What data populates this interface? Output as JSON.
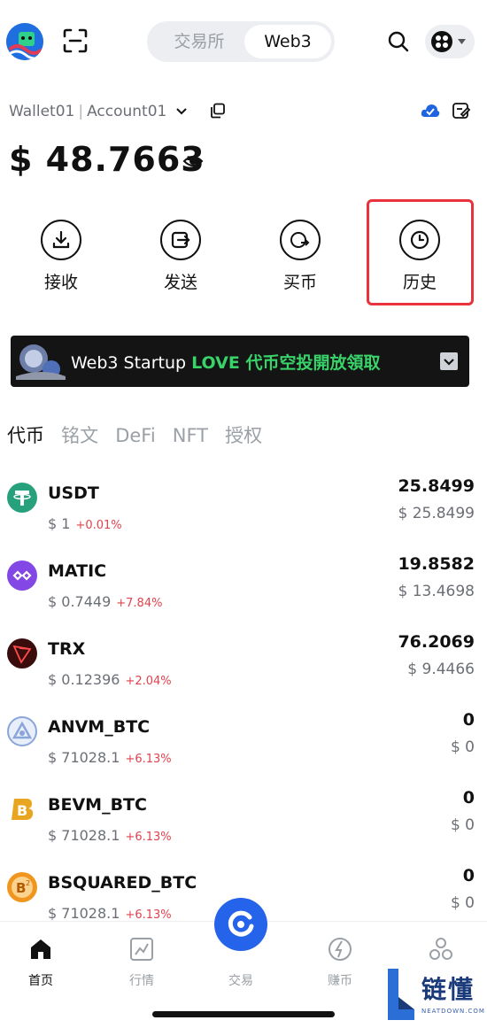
{
  "header": {
    "segment_options": [
      "交易所",
      "Web3"
    ],
    "selected_segment": "Web3"
  },
  "wallet": {
    "wallet_name": "Wallet01",
    "account_name": "Account01",
    "balance": "$ 48.7663"
  },
  "actions": [
    {
      "label": "接收",
      "icon": "receive-icon"
    },
    {
      "label": "发送",
      "icon": "send-icon"
    },
    {
      "label": "买币",
      "icon": "buy-icon"
    },
    {
      "label": "历史",
      "icon": "history-icon"
    }
  ],
  "banner": {
    "text_white": "Web3 Startup ",
    "text_green": "LOVE 代币空投開放領取"
  },
  "tabs": [
    "代币",
    "铭文",
    "DeFi",
    "NFT",
    "授权"
  ],
  "active_tab": "代币",
  "tokens": [
    {
      "symbol": "USDT",
      "price": "$ 1",
      "change": "+0.01%",
      "amount": "25.8499",
      "value": "$ 25.8499",
      "color": "#26a17b"
    },
    {
      "symbol": "MATIC",
      "price": "$ 0.7449",
      "change": "+7.84%",
      "amount": "19.8582",
      "value": "$ 13.4698",
      "color": "#8247e5"
    },
    {
      "symbol": "TRX",
      "price": "$ 0.12396",
      "change": "+2.04%",
      "amount": "76.2069",
      "value": "$ 9.4466",
      "color": "#3a0c0c"
    },
    {
      "symbol": "ANVM_BTC",
      "price": "$ 71028.1",
      "change": "+6.13%",
      "amount": "0",
      "value": "$ 0",
      "color": "#8aa6d8"
    },
    {
      "symbol": "BEVM_BTC",
      "price": "$ 71028.1",
      "change": "+6.13%",
      "amount": "0",
      "value": "$ 0",
      "color": "#e8a520"
    },
    {
      "symbol": "BSQUARED_BTC",
      "price": "$ 71028.1",
      "change": "+6.13%",
      "amount": "0",
      "value": "$ 0",
      "color": "#f0961e"
    }
  ],
  "bottom_nav": [
    {
      "label": "首页",
      "icon": "home-icon"
    },
    {
      "label": "行情",
      "icon": "market-icon"
    },
    {
      "label": "交易",
      "icon": "trade-icon"
    },
    {
      "label": "赚币",
      "icon": "earn-icon"
    },
    {
      "label": "",
      "icon": "discover-icon"
    }
  ],
  "watermark": {
    "title": "链懂",
    "subtitle": "NEATDOWN.COM"
  },
  "colors": {
    "accent": "#2563eb",
    "positive_change": "#e0434d",
    "banner_green": "#38d46a",
    "highlight_border": "#e8323c"
  }
}
